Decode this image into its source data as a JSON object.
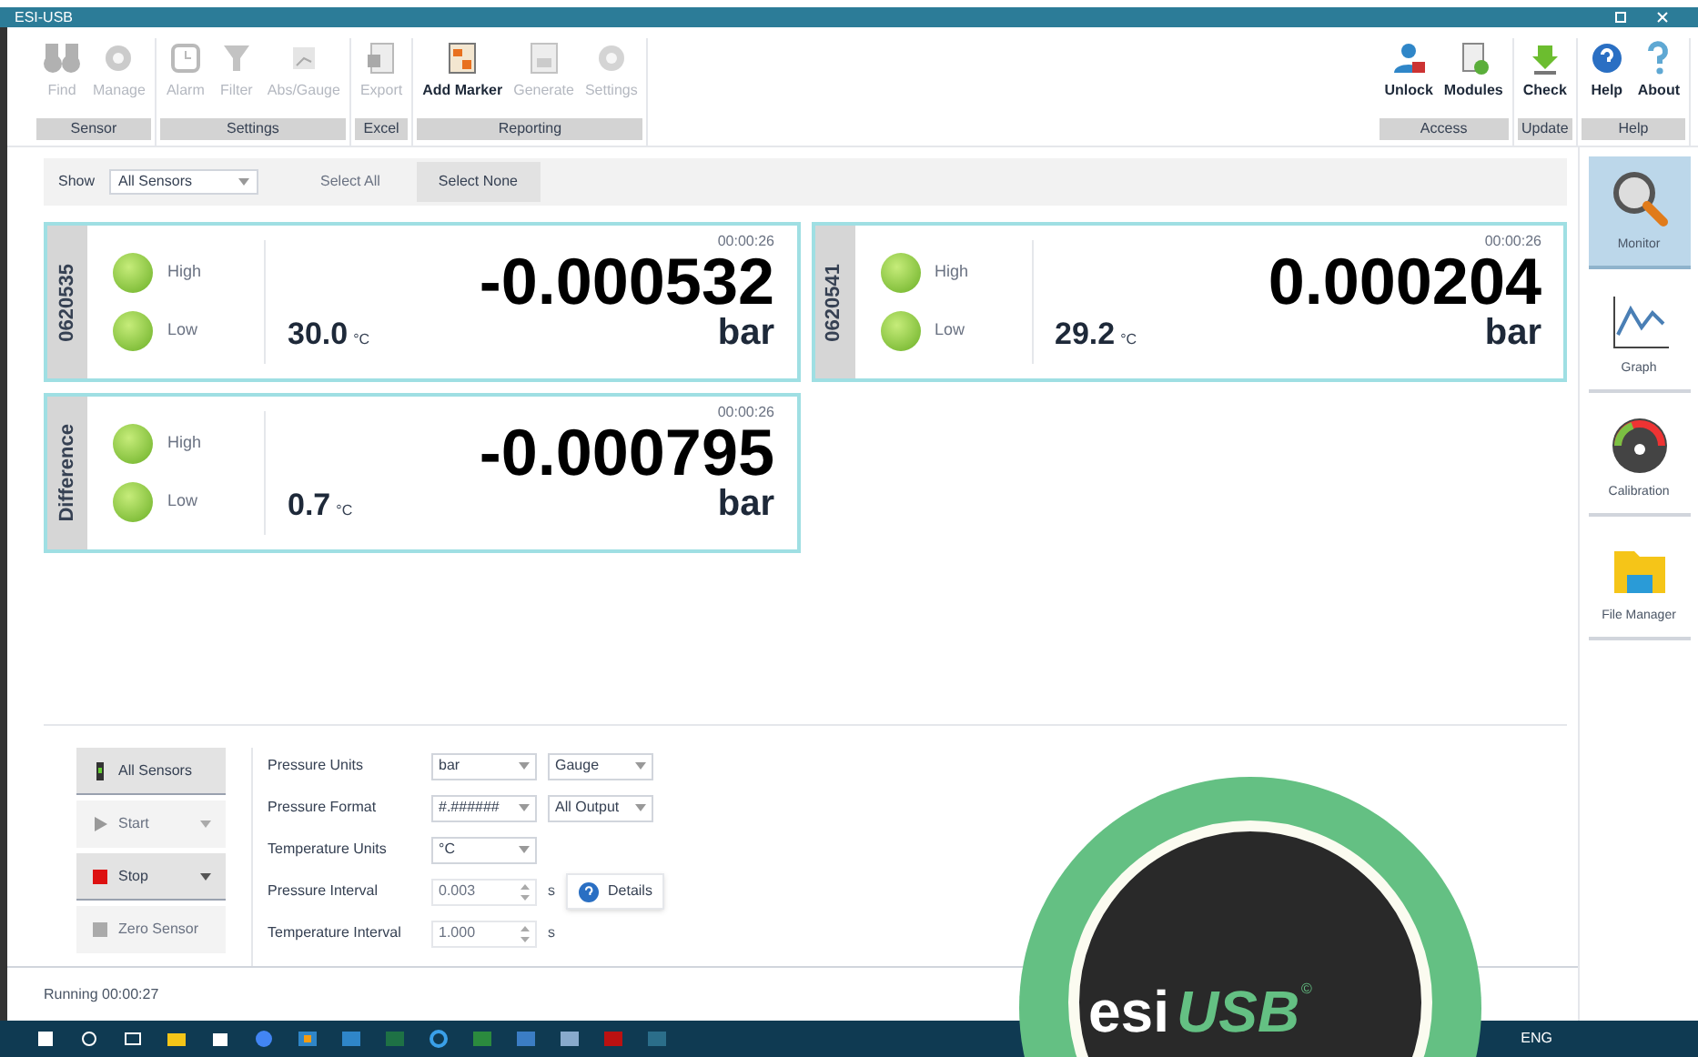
{
  "window": {
    "title": "ESI-USB"
  },
  "ribbon": {
    "groups": [
      {
        "label": "Sensor",
        "items": [
          {
            "label": "Find",
            "disabled": true
          },
          {
            "label": "Manage",
            "disabled": true
          }
        ]
      },
      {
        "label": "Settings",
        "items": [
          {
            "label": "Alarm",
            "disabled": true
          },
          {
            "label": "Filter",
            "disabled": true
          },
          {
            "label": "Abs/Gauge",
            "disabled": true
          }
        ]
      },
      {
        "label": "Excel",
        "items": [
          {
            "label": "Export",
            "disabled": true
          }
        ]
      },
      {
        "label": "Reporting",
        "items": [
          {
            "label": "Add Marker",
            "disabled": false
          },
          {
            "label": "Generate",
            "disabled": true
          },
          {
            "label": "Settings",
            "disabled": true
          }
        ]
      }
    ],
    "right_groups": [
      {
        "label": "Access",
        "items": [
          {
            "label": "Unlock",
            "disabled": false
          },
          {
            "label": "Modules",
            "disabled": false
          }
        ]
      },
      {
        "label": "Update",
        "items": [
          {
            "label": "Check",
            "disabled": false
          }
        ]
      },
      {
        "label": "Help",
        "items": [
          {
            "label": "Help",
            "disabled": false
          },
          {
            "label": "About",
            "disabled": false
          }
        ]
      }
    ]
  },
  "filter": {
    "label": "Show",
    "value": "All Sensors",
    "buttons": [
      {
        "label": "Select All",
        "disabled": true
      },
      {
        "label": "Select None",
        "disabled": false
      }
    ]
  },
  "sensors": [
    {
      "name": "0620535",
      "high": "High",
      "low": "Low",
      "time": "00:00:26",
      "value": "-0.000532",
      "unit": "bar",
      "temperature": "30.0",
      "temp_unit": "°C"
    },
    {
      "name": "0620541",
      "high": "High",
      "low": "Low",
      "time": "00:00:26",
      "value": "0.000204",
      "unit": "bar",
      "temperature": "29.2",
      "temp_unit": "°C"
    },
    {
      "name": "Difference",
      "high": "High",
      "low": "Low",
      "time": "00:00:26",
      "value": "-0.000795",
      "unit": "bar",
      "temperature": "0.7",
      "temp_unit": "°C"
    }
  ],
  "sidebar": {
    "items": [
      {
        "label": "Monitor",
        "selected": true
      },
      {
        "label": "Graph",
        "selected": false
      },
      {
        "label": "Calibration",
        "selected": false
      },
      {
        "label": "File Manager",
        "selected": false
      }
    ]
  },
  "controls": [
    {
      "label": "All Sensors",
      "disabled": false,
      "dropdown": false
    },
    {
      "label": "Start",
      "disabled": true,
      "dropdown": true
    },
    {
      "label": "Stop",
      "disabled": false,
      "dropdown": true
    },
    {
      "label": "Zero Sensor",
      "disabled": true,
      "dropdown": false
    }
  ],
  "settings": [
    {
      "label": "Pressure Units",
      "fields": [
        {
          "kind": "select",
          "value": "bar",
          "disabled": false
        },
        {
          "kind": "select",
          "value": "Gauge",
          "disabled": false
        }
      ]
    },
    {
      "label": "Pressure Format",
      "fields": [
        {
          "kind": "select",
          "value": "#.######",
          "disabled": false
        },
        {
          "kind": "select",
          "value": "All Output",
          "disabled": false
        }
      ]
    },
    {
      "label": "Temperature Units",
      "fields": [
        {
          "kind": "select",
          "value": "°C",
          "disabled": false
        }
      ]
    },
    {
      "label": "Pressure Interval",
      "fields": [
        {
          "kind": "spin",
          "value": "0.003",
          "disabled": true,
          "unit": "s"
        },
        {
          "kind": "button",
          "value": "Details",
          "disabled": false
        }
      ]
    },
    {
      "label": "Temperature Interval",
      "fields": [
        {
          "kind": "spin",
          "value": "1.000",
          "disabled": true,
          "unit": "s"
        }
      ]
    }
  ],
  "status_bar": {
    "text": "Running 00:00:27"
  },
  "taskbar": {
    "tray_text": "ENG"
  },
  "badge": {
    "brand": "esi",
    "product": "USB",
    "mark": "©"
  }
}
